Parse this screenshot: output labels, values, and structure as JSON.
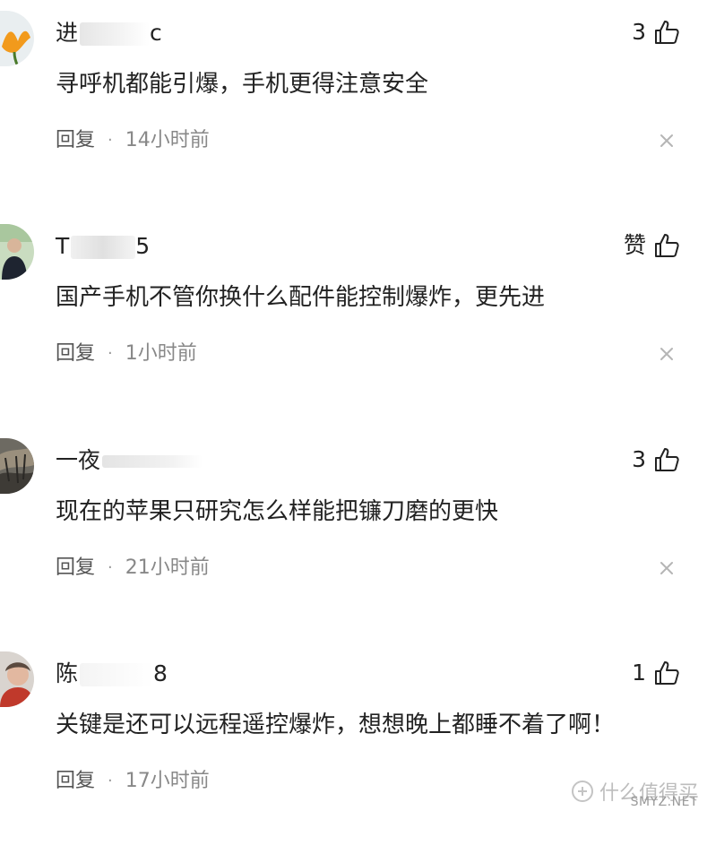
{
  "comments": [
    {
      "username": "进",
      "username_tail": "c",
      "like_label": "3",
      "content": "寻呼机都能引爆，手机更得注意安全",
      "reply_label": "回复",
      "separator": "·",
      "time": "14小时前"
    },
    {
      "username": "T",
      "username_tail": "5",
      "like_label": "赞",
      "content": "国产手机不管你换什么配件能控制爆炸，更先进",
      "reply_label": "回复",
      "separator": "·",
      "time": "1小时前"
    },
    {
      "username": "一夜",
      "username_tail": "",
      "like_label": "3",
      "content": "现在的苹果只研究怎么样能把镰刀磨的更快",
      "reply_label": "回复",
      "separator": "·",
      "time": "21小时前"
    },
    {
      "username": "陈",
      "username_tail": "8",
      "like_label": "1",
      "content": "关键是还可以远程遥控爆炸，想想晚上都睡不着了啊！",
      "reply_label": "回复",
      "separator": "·",
      "time": "17小时前"
    }
  ],
  "watermark": {
    "text": "什么值得买",
    "site": "SMYZ.NET"
  },
  "icons": {
    "like": "thumbs-up-icon",
    "close": "close-icon"
  }
}
